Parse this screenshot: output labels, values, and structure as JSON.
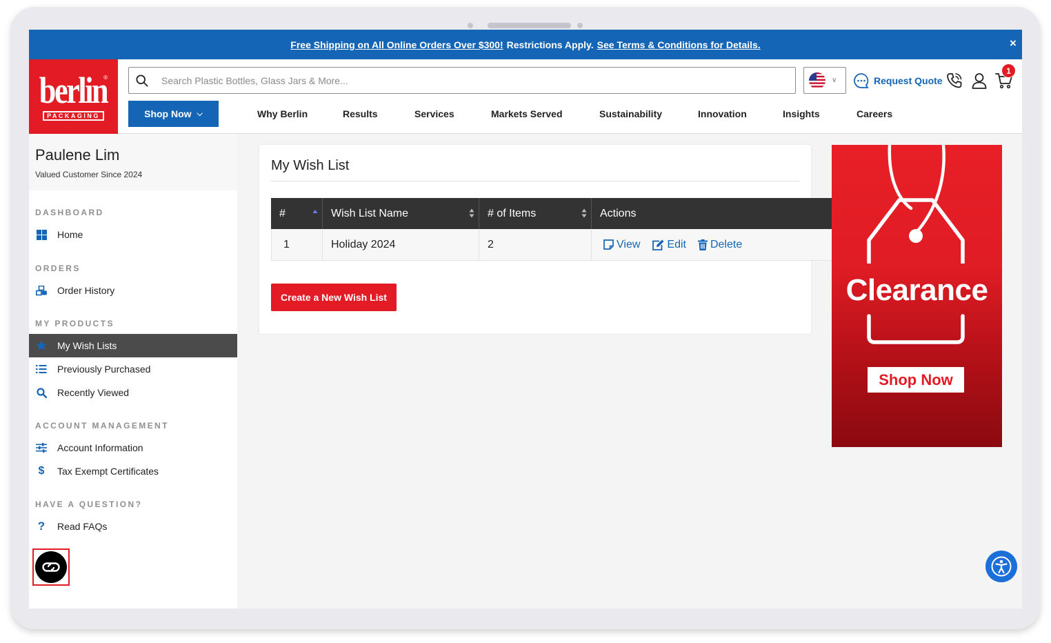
{
  "promo": {
    "link1": "Free Shipping on All Online Orders Over $300!",
    "middle": "Restrictions Apply.",
    "link2": "See Terms & Conditions for Details.",
    "close": "×"
  },
  "header": {
    "logo_word": "berlin",
    "logo_sub": "PACKAGING",
    "logo_reg": "®",
    "search_placeholder": "Search Plastic Bottles, Glass Jars & More...",
    "request_quote": "Request Quote",
    "cart_count": "1",
    "shop_now": "Shop Now",
    "nav": [
      "Why Berlin",
      "Results",
      "Services",
      "Markets Served",
      "Sustainability",
      "Innovation",
      "Insights",
      "Careers"
    ]
  },
  "sidebar": {
    "name": "Paulene Lim",
    "since": "Valued Customer Since 2024",
    "sections": {
      "dashboard": "DASHBOARD",
      "orders": "ORDERS",
      "products": "MY PRODUCTS",
      "account": "ACCOUNT MANAGEMENT",
      "question": "HAVE A QUESTION?"
    },
    "items": {
      "home": "Home",
      "order_history": "Order History",
      "wish_lists": "My Wish Lists",
      "previously_purchased": "Previously Purchased",
      "recently_viewed": "Recently Viewed",
      "account_info": "Account Information",
      "tax_exempt": "Tax Exempt Certificates",
      "faqs": "Read FAQs"
    }
  },
  "main": {
    "title": "My Wish List",
    "columns": [
      "#",
      "Wish List Name",
      "# of Items",
      "Actions"
    ],
    "rows": [
      {
        "num": "1",
        "name": "Holiday 2024",
        "items": "2"
      }
    ],
    "actions": {
      "view": "View",
      "edit": "Edit",
      "delete": "Delete"
    },
    "create_button": "Create a New Wish List"
  },
  "ad": {
    "title": "Clearance",
    "button": "Shop Now"
  },
  "colors": {
    "brand_red": "#e21b25",
    "brand_blue": "#1565b6",
    "table_header": "#333333",
    "active_item": "#4b4b4b"
  }
}
